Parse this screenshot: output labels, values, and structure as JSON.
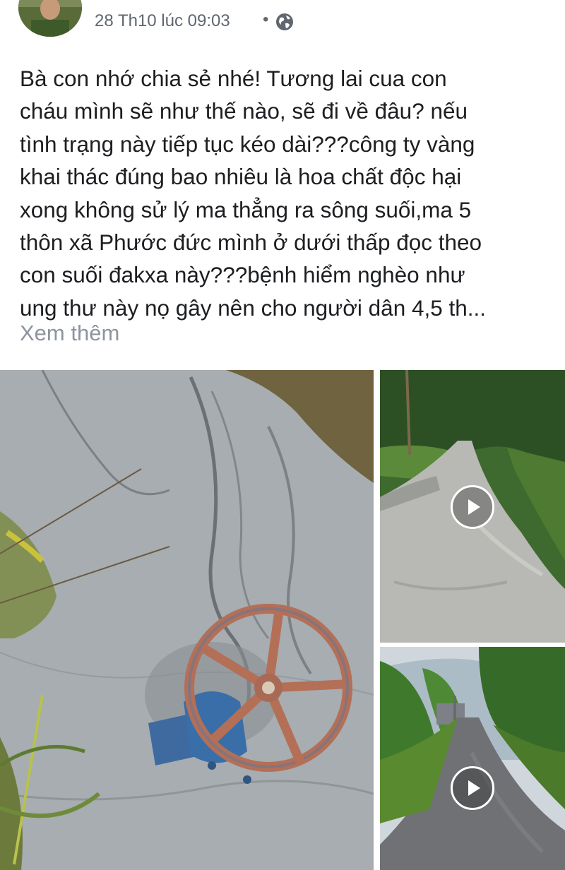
{
  "post": {
    "timestamp": "28 Th10 lúc 09:03",
    "separator": "•",
    "privacy_icon": "globe-icon",
    "text_lines": [
      "Bà con nhớ chia sẻ nhé! Tương lai cua con",
      "cháu mình sẽ như thế nào, sẽ đi về đâu? nếu",
      "tình trạng này tiếp tục kéo dài???công ty vàng",
      "khai thác đúng bao nhiêu là hoa chất độc hại",
      "xong không sử lý ma thẳng ra sông suối,ma 5",
      "thôn xã Phước đức mình ở dưới thấp đọc theo",
      "con suối đakxa này???bệnh hiểm nghèo như",
      "ung thư này nọ gây nên cho người dân 4,5 th..."
    ],
    "see_more": "Xem thêm"
  },
  "media": {
    "items": [
      {
        "kind": "photo",
        "icon": "valve-photo"
      },
      {
        "kind": "video",
        "icon": "play-icon"
      },
      {
        "kind": "video",
        "icon": "play-icon"
      }
    ]
  },
  "colors": {
    "text": "#1c1e21",
    "meta": "#606770",
    "see_more": "#8d949e"
  }
}
